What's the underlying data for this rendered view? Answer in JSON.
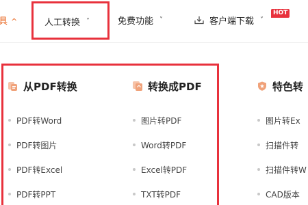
{
  "nav": {
    "edge_label": "具",
    "edge_caret": "^",
    "items": [
      {
        "label": "人工转换",
        "active": true
      },
      {
        "label": "免费功能"
      },
      {
        "label": "客户端下载",
        "badge": "HOT"
      }
    ],
    "chevron": "˅"
  },
  "columns": [
    {
      "title": "从PDF转换",
      "icon": "pdf-convert-icon",
      "links": [
        "PDF转Word",
        "PDF转图片",
        "PDF转Excel",
        "PDF转PPT"
      ]
    },
    {
      "title": "转换成PDF",
      "icon": "to-pdf-icon",
      "links": [
        "图片转PDF",
        "Word转PDF",
        "Excel转PDF",
        "TXT转PDF"
      ]
    },
    {
      "title": "特色转",
      "icon": "feature-shield-icon",
      "links": [
        "图片转Ex",
        "扫描件转",
        "扫描件转W",
        "CAD版本"
      ]
    }
  ],
  "colors": {
    "accent": "#e8651f",
    "highlight": "#e8313c",
    "icon_orange": "#f0a27a"
  }
}
